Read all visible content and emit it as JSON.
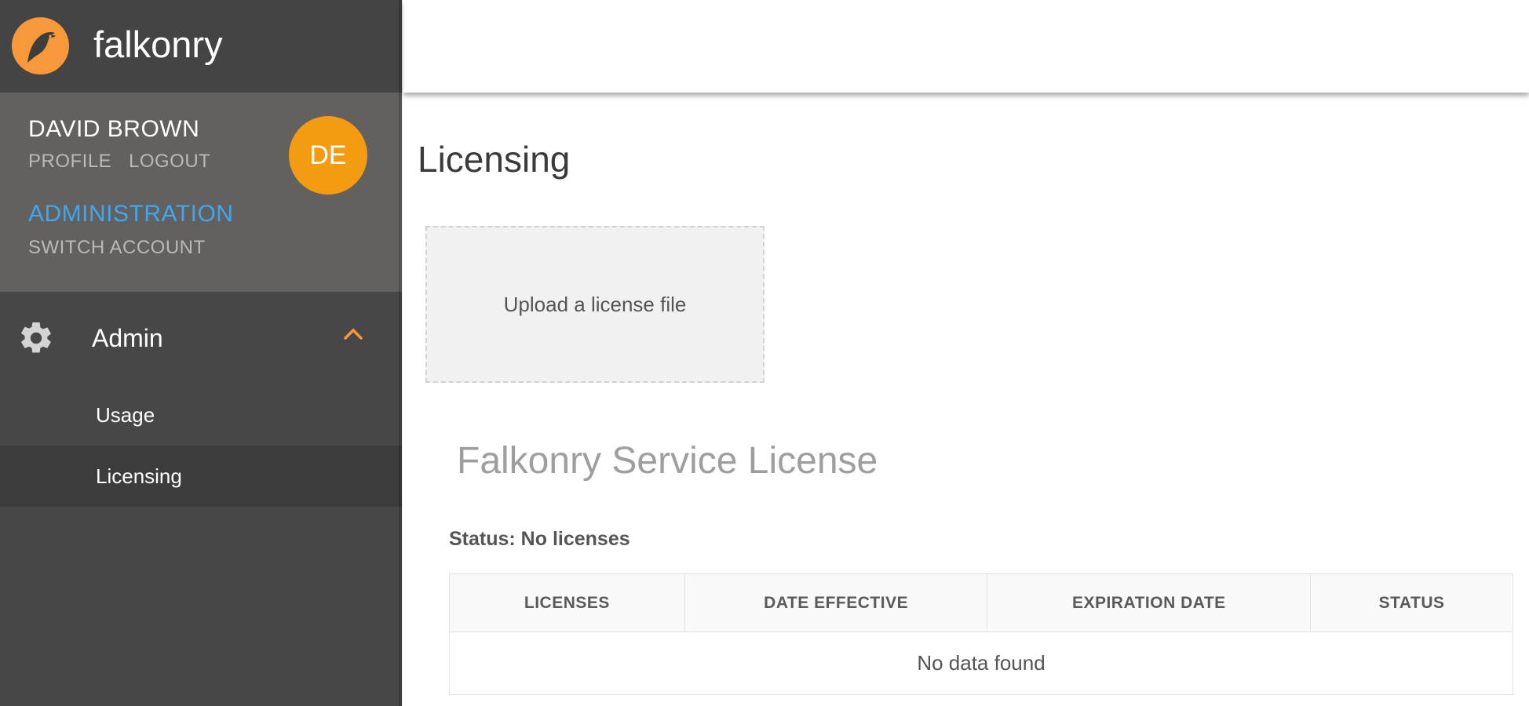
{
  "brand": {
    "name": "falkonry",
    "logo_icon": "falcon-logo-icon",
    "logo_color": "#f7993b"
  },
  "user": {
    "name": "DAVID BROWN",
    "profile_label": "PROFILE",
    "logout_label": "LOGOUT",
    "administration_label": "ADMINISTRATION",
    "switch_account_label": "SWITCH ACCOUNT",
    "avatar_initials": "DE",
    "avatar_color": "#f39c12"
  },
  "sidebar": {
    "section": {
      "label": "Admin",
      "icon": "gear-icon",
      "expanded": true,
      "chevron_icon": "chevron-up-icon"
    },
    "items": [
      {
        "label": "Usage",
        "active": false
      },
      {
        "label": "Licensing",
        "active": true
      }
    ]
  },
  "main": {
    "title": "Licensing",
    "upload_label": "Upload a license file",
    "section_title": "Falkonry Service License",
    "status_text": "Status: No licenses",
    "table": {
      "columns": [
        "LICENSES",
        "DATE EFFECTIVE",
        "EXPIRATION DATE",
        "STATUS"
      ],
      "rows": [],
      "empty_text": "No data found"
    }
  },
  "colors": {
    "accent_blue": "#3fa7f0",
    "accent_orange": "#f7993b",
    "sidebar_bg": "#474747"
  }
}
